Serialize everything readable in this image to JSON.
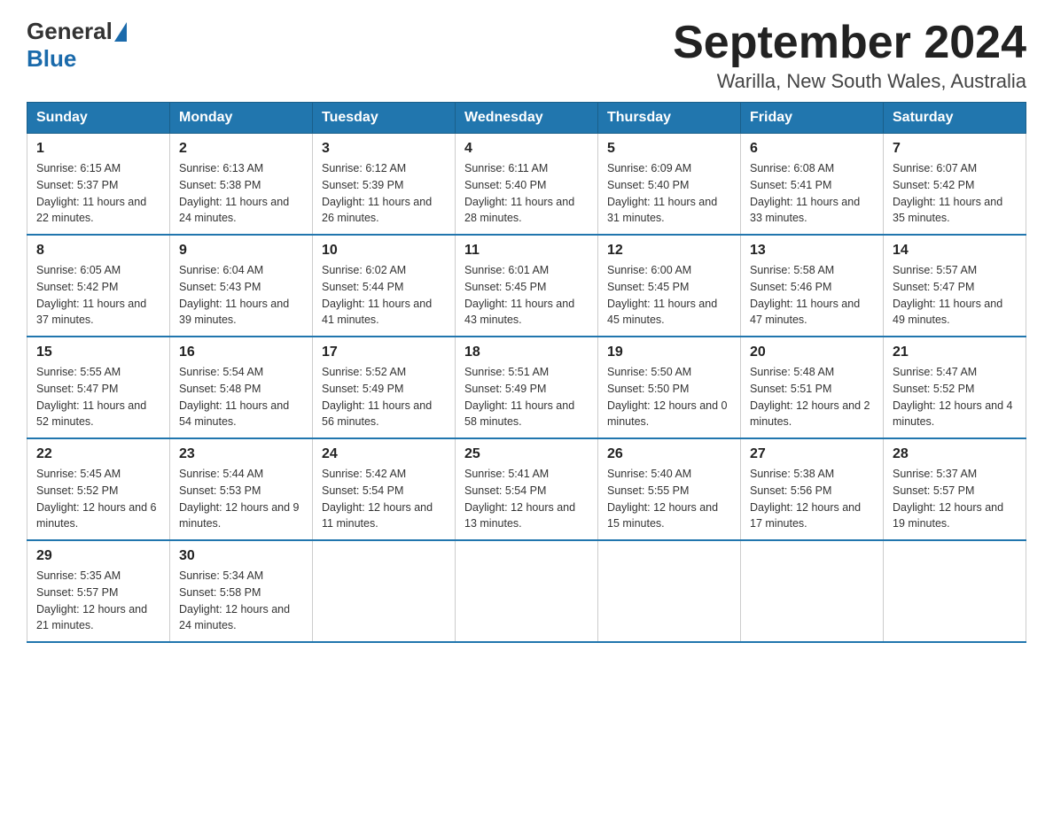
{
  "header": {
    "logo_general": "General",
    "logo_blue": "Blue",
    "month_title": "September 2024",
    "location": "Warilla, New South Wales, Australia"
  },
  "days_of_week": [
    "Sunday",
    "Monday",
    "Tuesday",
    "Wednesday",
    "Thursday",
    "Friday",
    "Saturday"
  ],
  "weeks": [
    [
      {
        "num": "1",
        "sunrise": "6:15 AM",
        "sunset": "5:37 PM",
        "daylight": "11 hours and 22 minutes."
      },
      {
        "num": "2",
        "sunrise": "6:13 AM",
        "sunset": "5:38 PM",
        "daylight": "11 hours and 24 minutes."
      },
      {
        "num": "3",
        "sunrise": "6:12 AM",
        "sunset": "5:39 PM",
        "daylight": "11 hours and 26 minutes."
      },
      {
        "num": "4",
        "sunrise": "6:11 AM",
        "sunset": "5:40 PM",
        "daylight": "11 hours and 28 minutes."
      },
      {
        "num": "5",
        "sunrise": "6:09 AM",
        "sunset": "5:40 PM",
        "daylight": "11 hours and 31 minutes."
      },
      {
        "num": "6",
        "sunrise": "6:08 AM",
        "sunset": "5:41 PM",
        "daylight": "11 hours and 33 minutes."
      },
      {
        "num": "7",
        "sunrise": "6:07 AM",
        "sunset": "5:42 PM",
        "daylight": "11 hours and 35 minutes."
      }
    ],
    [
      {
        "num": "8",
        "sunrise": "6:05 AM",
        "sunset": "5:42 PM",
        "daylight": "11 hours and 37 minutes."
      },
      {
        "num": "9",
        "sunrise": "6:04 AM",
        "sunset": "5:43 PM",
        "daylight": "11 hours and 39 minutes."
      },
      {
        "num": "10",
        "sunrise": "6:02 AM",
        "sunset": "5:44 PM",
        "daylight": "11 hours and 41 minutes."
      },
      {
        "num": "11",
        "sunrise": "6:01 AM",
        "sunset": "5:45 PM",
        "daylight": "11 hours and 43 minutes."
      },
      {
        "num": "12",
        "sunrise": "6:00 AM",
        "sunset": "5:45 PM",
        "daylight": "11 hours and 45 minutes."
      },
      {
        "num": "13",
        "sunrise": "5:58 AM",
        "sunset": "5:46 PM",
        "daylight": "11 hours and 47 minutes."
      },
      {
        "num": "14",
        "sunrise": "5:57 AM",
        "sunset": "5:47 PM",
        "daylight": "11 hours and 49 minutes."
      }
    ],
    [
      {
        "num": "15",
        "sunrise": "5:55 AM",
        "sunset": "5:47 PM",
        "daylight": "11 hours and 52 minutes."
      },
      {
        "num": "16",
        "sunrise": "5:54 AM",
        "sunset": "5:48 PM",
        "daylight": "11 hours and 54 minutes."
      },
      {
        "num": "17",
        "sunrise": "5:52 AM",
        "sunset": "5:49 PM",
        "daylight": "11 hours and 56 minutes."
      },
      {
        "num": "18",
        "sunrise": "5:51 AM",
        "sunset": "5:49 PM",
        "daylight": "11 hours and 58 minutes."
      },
      {
        "num": "19",
        "sunrise": "5:50 AM",
        "sunset": "5:50 PM",
        "daylight": "12 hours and 0 minutes."
      },
      {
        "num": "20",
        "sunrise": "5:48 AM",
        "sunset": "5:51 PM",
        "daylight": "12 hours and 2 minutes."
      },
      {
        "num": "21",
        "sunrise": "5:47 AM",
        "sunset": "5:52 PM",
        "daylight": "12 hours and 4 minutes."
      }
    ],
    [
      {
        "num": "22",
        "sunrise": "5:45 AM",
        "sunset": "5:52 PM",
        "daylight": "12 hours and 6 minutes."
      },
      {
        "num": "23",
        "sunrise": "5:44 AM",
        "sunset": "5:53 PM",
        "daylight": "12 hours and 9 minutes."
      },
      {
        "num": "24",
        "sunrise": "5:42 AM",
        "sunset": "5:54 PM",
        "daylight": "12 hours and 11 minutes."
      },
      {
        "num": "25",
        "sunrise": "5:41 AM",
        "sunset": "5:54 PM",
        "daylight": "12 hours and 13 minutes."
      },
      {
        "num": "26",
        "sunrise": "5:40 AM",
        "sunset": "5:55 PM",
        "daylight": "12 hours and 15 minutes."
      },
      {
        "num": "27",
        "sunrise": "5:38 AM",
        "sunset": "5:56 PM",
        "daylight": "12 hours and 17 minutes."
      },
      {
        "num": "28",
        "sunrise": "5:37 AM",
        "sunset": "5:57 PM",
        "daylight": "12 hours and 19 minutes."
      }
    ],
    [
      {
        "num": "29",
        "sunrise": "5:35 AM",
        "sunset": "5:57 PM",
        "daylight": "12 hours and 21 minutes."
      },
      {
        "num": "30",
        "sunrise": "5:34 AM",
        "sunset": "5:58 PM",
        "daylight": "12 hours and 24 minutes."
      },
      null,
      null,
      null,
      null,
      null
    ]
  ]
}
